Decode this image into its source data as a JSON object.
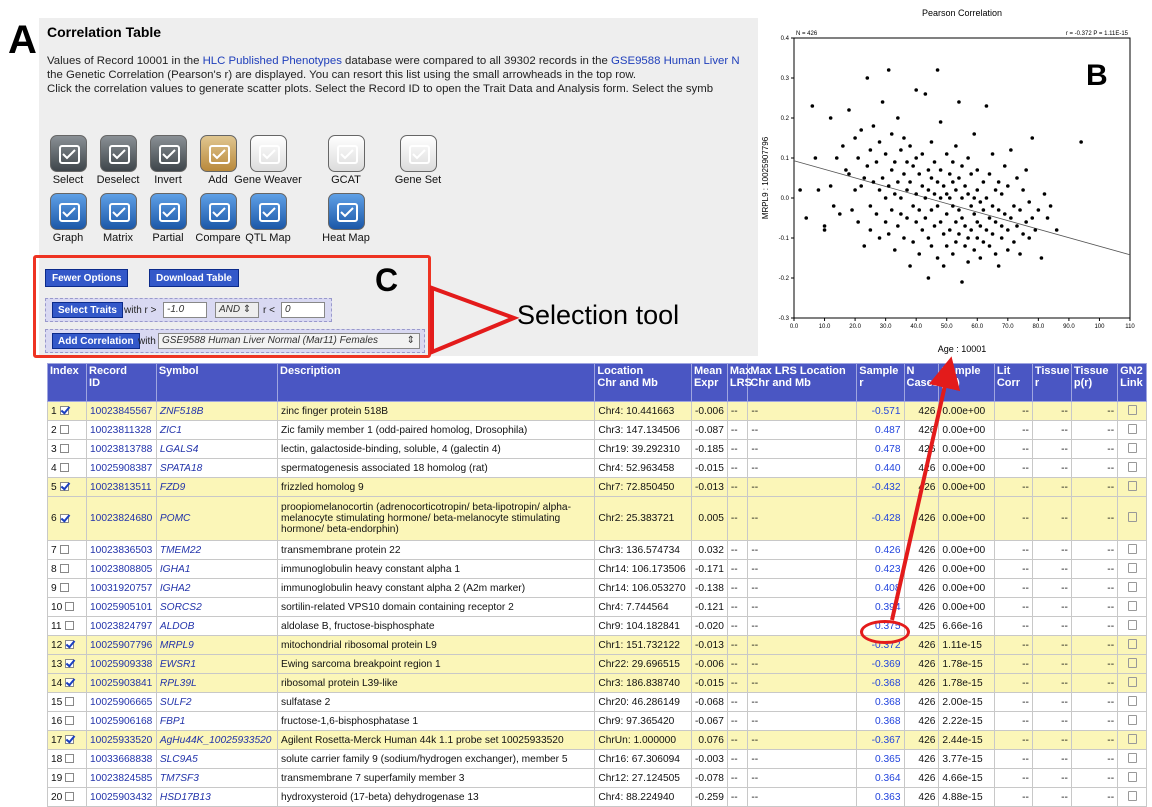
{
  "panel_labels": {
    "a": "A",
    "b": "B",
    "c": "C"
  },
  "header": {
    "title": "Correlation Table",
    "line1_pre": "Values of Record 10001 in the ",
    "line1_db1": "HLC Published Phenotypes",
    "line1_mid": " database were compared to all 39302 records in the ",
    "line1_db2": "GSE9588 Human Liver N",
    "line2": "the Genetic Correlation (Pearson's r) are displayed. You can resort this list using the small arrowheads in the top row.",
    "line3": "Click the correlation values to generate scatter plots. Select the Record ID to open the Trait Data and Analysis form. Select the symb"
  },
  "tools_row1": [
    "Select",
    "Deselect",
    "Invert",
    "Add",
    "Gene Weaver",
    "GCAT",
    "Gene Set"
  ],
  "tools_row2": [
    "Graph",
    "Matrix",
    "Partial",
    "Compare",
    "QTL Map",
    "Heat Map"
  ],
  "options": {
    "fewer_options": "Fewer Options",
    "download_table": "Download Table",
    "select_traits": "Select Traits",
    "with_r_gt": "with r >",
    "r_min": "-1.0",
    "logic": "AND",
    "r_lt": "r <",
    "r_max": "0",
    "add_correlation": "Add Correlation",
    "with": "with",
    "dataset": "GSE9588 Human Liver Normal (Mar11) Females"
  },
  "annotation": {
    "selection_tool": "Selection tool"
  },
  "colors": {
    "header_blue": "#4a56c3",
    "selected_row": "#fbf6b8",
    "red": "#e31b1b",
    "button_blue": "#3358c9"
  },
  "chart_data": {
    "type": "scatter",
    "title": "Pearson Correlation",
    "xlabel": "Age : 10001",
    "ylabel": "MRPL9 : 10025907796",
    "n_label": "N = 426",
    "stat_label": "r = -0.372 P = 1.11E-15",
    "xlim": [
      0,
      110
    ],
    "ylim": [
      -0.3,
      0.4
    ],
    "xticks": [
      "0.0",
      "10.0",
      "20.0",
      "30.0",
      "40.0",
      "50.0",
      "60.0",
      "70.0",
      "80.0",
      "90.0",
      "100",
      "110"
    ],
    "yticks": [
      "-0.3",
      "-0.2",
      "-0.1",
      "0.0",
      "0.1",
      "0.2",
      "0.3",
      "0.4"
    ],
    "regression": {
      "x": [
        0,
        110
      ],
      "y": [
        0.093,
        -0.142
      ]
    },
    "points": [
      [
        2,
        0.02
      ],
      [
        4,
        -0.05
      ],
      [
        6,
        0.23
      ],
      [
        7,
        0.1
      ],
      [
        8,
        0.02
      ],
      [
        10,
        -0.08
      ],
      [
        10,
        -0.07
      ],
      [
        12,
        0.2
      ],
      [
        12,
        0.03
      ],
      [
        13,
        -0.02
      ],
      [
        14,
        0.1
      ],
      [
        15,
        -0.04
      ],
      [
        16,
        0.13
      ],
      [
        17,
        0.07
      ],
      [
        18,
        0.22
      ],
      [
        18,
        0.06
      ],
      [
        19,
        -0.03
      ],
      [
        20,
        0.15
      ],
      [
        20,
        0.02
      ],
      [
        21,
        0.1
      ],
      [
        21,
        -0.06
      ],
      [
        22,
        0.03
      ],
      [
        22,
        0.17
      ],
      [
        23,
        -0.12
      ],
      [
        23,
        0.05
      ],
      [
        24,
        0.3
      ],
      [
        24,
        0.08
      ],
      [
        25,
        0.12
      ],
      [
        25,
        -0.02
      ],
      [
        25,
        -0.08
      ],
      [
        26,
        0.04
      ],
      [
        26,
        0.18
      ],
      [
        27,
        -0.04
      ],
      [
        27,
        0.09
      ],
      [
        28,
        0.02
      ],
      [
        28,
        -0.1
      ],
      [
        28,
        0.14
      ],
      [
        29,
        0.24
      ],
      [
        29,
        0.05
      ],
      [
        30,
        -0.06
      ],
      [
        30,
        0.11
      ],
      [
        30,
        0.0
      ],
      [
        31,
        0.32
      ],
      [
        31,
        0.03
      ],
      [
        31,
        -0.09
      ],
      [
        32,
        0.07
      ],
      [
        32,
        -0.03
      ],
      [
        32,
        0.16
      ],
      [
        33,
        -0.13
      ],
      [
        33,
        0.01
      ],
      [
        33,
        0.09
      ],
      [
        34,
        0.04
      ],
      [
        34,
        -0.07
      ],
      [
        34,
        0.2
      ],
      [
        35,
        0.0
      ],
      [
        35,
        0.12
      ],
      [
        35,
        -0.04
      ],
      [
        36,
        0.06
      ],
      [
        36,
        -0.1
      ],
      [
        36,
        0.15
      ],
      [
        37,
        0.02
      ],
      [
        37,
        -0.05
      ],
      [
        37,
        0.09
      ],
      [
        38,
        -0.17
      ],
      [
        38,
        0.04
      ],
      [
        38,
        0.13
      ],
      [
        39,
        -0.02
      ],
      [
        39,
        0.08
      ],
      [
        39,
        -0.11
      ],
      [
        40,
        0.01
      ],
      [
        40,
        0.27
      ],
      [
        40,
        -0.06
      ],
      [
        40,
        0.1
      ],
      [
        41,
        -0.03
      ],
      [
        41,
        0.06
      ],
      [
        41,
        -0.14
      ],
      [
        42,
        0.03
      ],
      [
        42,
        -0.08
      ],
      [
        42,
        0.11
      ],
      [
        43,
        0.26
      ],
      [
        43,
        0.0
      ],
      [
        43,
        -0.05
      ],
      [
        44,
        0.07
      ],
      [
        44,
        -0.1
      ],
      [
        44,
        0.02
      ],
      [
        44,
        -0.2
      ],
      [
        45,
        0.05
      ],
      [
        45,
        -0.03
      ],
      [
        45,
        0.14
      ],
      [
        45,
        -0.12
      ],
      [
        46,
        0.01
      ],
      [
        46,
        -0.07
      ],
      [
        46,
        0.09
      ],
      [
        47,
        0.32
      ],
      [
        47,
        -0.02
      ],
      [
        47,
        0.04
      ],
      [
        47,
        -0.15
      ],
      [
        48,
        0.19
      ],
      [
        48,
        -0.06
      ],
      [
        48,
        0.0
      ],
      [
        48,
        0.07
      ],
      [
        49,
        -0.09
      ],
      [
        49,
        0.03
      ],
      [
        49,
        -0.17
      ],
      [
        50,
        0.11
      ],
      [
        50,
        -0.04
      ],
      [
        50,
        0.01
      ],
      [
        50,
        -0.12
      ],
      [
        51,
        0.06
      ],
      [
        51,
        -0.08
      ],
      [
        51,
        0.0
      ],
      [
        52,
        -0.02
      ],
      [
        52,
        0.09
      ],
      [
        52,
        -0.14
      ],
      [
        52,
        0.04
      ],
      [
        53,
        -0.06
      ],
      [
        53,
        0.02
      ],
      [
        53,
        -0.11
      ],
      [
        53,
        0.13
      ],
      [
        54,
        0.24
      ],
      [
        54,
        -0.03
      ],
      [
        54,
        0.05
      ],
      [
        54,
        -0.09
      ],
      [
        55,
        -0.21
      ],
      [
        55,
        0.0
      ],
      [
        55,
        -0.05
      ],
      [
        55,
        0.08
      ],
      [
        56,
        -0.12
      ],
      [
        56,
        0.03
      ],
      [
        56,
        -0.07
      ],
      [
        57,
        0.01
      ],
      [
        57,
        -0.1
      ],
      [
        57,
        0.1
      ],
      [
        57,
        -0.16
      ],
      [
        58,
        -0.02
      ],
      [
        58,
        0.06
      ],
      [
        58,
        -0.08
      ],
      [
        59,
        0.16
      ],
      [
        59,
        -0.04
      ],
      [
        59,
        0.0
      ],
      [
        59,
        -0.13
      ],
      [
        60,
        -0.06
      ],
      [
        60,
        0.02
      ],
      [
        60,
        -0.1
      ],
      [
        60,
        0.07
      ],
      [
        61,
        -0.15
      ],
      [
        61,
        -0.01
      ],
      [
        61,
        -0.07
      ],
      [
        62,
        0.04
      ],
      [
        62,
        -0.11
      ],
      [
        62,
        -0.03
      ],
      [
        63,
        0.23
      ],
      [
        63,
        -0.08
      ],
      [
        63,
        0.0
      ],
      [
        64,
        -0.05
      ],
      [
        64,
        -0.12
      ],
      [
        64,
        0.06
      ],
      [
        65,
        -0.02
      ],
      [
        65,
        -0.09
      ],
      [
        65,
        0.11
      ],
      [
        66,
        -0.14
      ],
      [
        66,
        0.02
      ],
      [
        66,
        -0.06
      ],
      [
        67,
        -0.17
      ],
      [
        67,
        -0.03
      ],
      [
        67,
        0.04
      ],
      [
        68,
        -0.1
      ],
      [
        68,
        0.01
      ],
      [
        68,
        -0.07
      ],
      [
        69,
        0.08
      ],
      [
        69,
        -0.04
      ],
      [
        70,
        -0.13
      ],
      [
        70,
        0.03
      ],
      [
        70,
        -0.08
      ],
      [
        71,
        0.12
      ],
      [
        71,
        -0.05
      ],
      [
        72,
        -0.02
      ],
      [
        72,
        -0.11
      ],
      [
        73,
        0.05
      ],
      [
        73,
        -0.07
      ],
      [
        74,
        -0.03
      ],
      [
        74,
        -0.14
      ],
      [
        75,
        0.02
      ],
      [
        75,
        -0.09
      ],
      [
        76,
        -0.06
      ],
      [
        76,
        0.07
      ],
      [
        77,
        -0.1
      ],
      [
        77,
        -0.01
      ],
      [
        78,
        0.15
      ],
      [
        78,
        -0.05
      ],
      [
        79,
        -0.08
      ],
      [
        80,
        -0.03
      ],
      [
        81,
        -0.15
      ],
      [
        82,
        0.01
      ],
      [
        83,
        -0.05
      ],
      [
        84,
        -0.02
      ],
      [
        86,
        -0.08
      ],
      [
        94,
        0.14
      ]
    ]
  },
  "table": {
    "columns": [
      {
        "l1": "Index",
        "l2": ""
      },
      {
        "l1": "Record",
        "l2": "ID"
      },
      {
        "l1": "Symbol",
        "l2": ""
      },
      {
        "l1": "Description",
        "l2": ""
      },
      {
        "l1": "Location",
        "l2": "Chr and Mb"
      },
      {
        "l1": "Mean",
        "l2": "Expr"
      },
      {
        "l1": "Max",
        "l2": "LRS"
      },
      {
        "l1": "Max LRS Location",
        "l2": "Chr and Mb"
      },
      {
        "l1": "Sample",
        "l2": "r"
      },
      {
        "l1": "N",
        "l2": "Cases"
      },
      {
        "l1": "Sample",
        "l2": "p(r)"
      },
      {
        "l1": "Lit",
        "l2": "Corr"
      },
      {
        "l1": "Tissue",
        "l2": "r"
      },
      {
        "l1": "Tissue",
        "l2": "p(r)"
      },
      {
        "l1": "GN2",
        "l2": "Link"
      }
    ],
    "rows": [
      {
        "i": "1",
        "c": true,
        "id": "10023845567",
        "sym": "ZNF518B",
        "desc": "zinc finger protein 518B",
        "loc": "Chr4: 10.441663",
        "mean": "-0.006",
        "lrs": "--",
        "lrsloc": "--",
        "r": "-0.571",
        "n": "426",
        "p": "0.00e+00",
        "lit": "--",
        "tr": "--",
        "tp": "--"
      },
      {
        "i": "2",
        "c": false,
        "id": "10023811328",
        "sym": "ZIC1",
        "desc": "Zic family member 1 (odd-paired homolog, Drosophila)",
        "loc": "Chr3: 147.134506",
        "mean": "-0.087",
        "lrs": "--",
        "lrsloc": "--",
        "r": "0.487",
        "n": "426",
        "p": "0.00e+00",
        "lit": "--",
        "tr": "--",
        "tp": "--"
      },
      {
        "i": "3",
        "c": false,
        "id": "10023813788",
        "sym": "LGALS4",
        "desc": "lectin, galactoside-binding, soluble, 4 (galectin 4)",
        "loc": "Chr19: 39.292310",
        "mean": "-0.185",
        "lrs": "--",
        "lrsloc": "--",
        "r": "0.478",
        "n": "426",
        "p": "0.00e+00",
        "lit": "--",
        "tr": "--",
        "tp": "--"
      },
      {
        "i": "4",
        "c": false,
        "id": "10025908387",
        "sym": "SPATA18",
        "desc": "spermatogenesis associated 18 homolog (rat)",
        "loc": "Chr4: 52.963458",
        "mean": "-0.015",
        "lrs": "--",
        "lrsloc": "--",
        "r": "0.440",
        "n": "426",
        "p": "0.00e+00",
        "lit": "--",
        "tr": "--",
        "tp": "--"
      },
      {
        "i": "5",
        "c": true,
        "id": "10023813511",
        "sym": "FZD9",
        "desc": "frizzled homolog 9",
        "loc": "Chr7: 72.850450",
        "mean": "-0.013",
        "lrs": "--",
        "lrsloc": "--",
        "r": "-0.432",
        "n": "426",
        "p": "0.00e+00",
        "lit": "--",
        "tr": "--",
        "tp": "--"
      },
      {
        "i": "6",
        "c": true,
        "id": "10023824680",
        "sym": "POMC",
        "desc": "proopiomelanocortin (adrenocorticotropin/ beta-lipotropin/ alpha-melanocyte stimulating hormone/ beta-melanocyte stimulating hormone/ beta-endorphin)",
        "loc": "Chr2: 25.383721",
        "mean": "0.005",
        "lrs": "--",
        "lrsloc": "--",
        "r": "-0.428",
        "n": "426",
        "p": "0.00e+00",
        "lit": "--",
        "tr": "--",
        "tp": "--",
        "tall": true
      },
      {
        "i": "7",
        "c": false,
        "id": "10023836503",
        "sym": "TMEM22",
        "desc": "transmembrane protein 22",
        "loc": "Chr3: 136.574734",
        "mean": "0.032",
        "lrs": "--",
        "lrsloc": "--",
        "r": "0.426",
        "n": "426",
        "p": "0.00e+00",
        "lit": "--",
        "tr": "--",
        "tp": "--"
      },
      {
        "i": "8",
        "c": false,
        "id": "10023808805",
        "sym": "IGHA1",
        "desc": "immunoglobulin heavy constant alpha 1",
        "loc": "Chr14: 106.173506",
        "mean": "-0.171",
        "lrs": "--",
        "lrsloc": "--",
        "r": "0.423",
        "n": "426",
        "p": "0.00e+00",
        "lit": "--",
        "tr": "--",
        "tp": "--"
      },
      {
        "i": "9",
        "c": false,
        "id": "10031920757",
        "sym": "IGHA2",
        "desc": "immunoglobulin heavy constant alpha 2 (A2m marker)",
        "loc": "Chr14: 106.053270",
        "mean": "-0.138",
        "lrs": "--",
        "lrsloc": "--",
        "r": "0.408",
        "n": "426",
        "p": "0.00e+00",
        "lit": "--",
        "tr": "--",
        "tp": "--"
      },
      {
        "i": "10",
        "c": false,
        "id": "10025905101",
        "sym": "SORCS2",
        "desc": "sortilin-related VPS10 domain containing receptor 2",
        "loc": "Chr4: 7.744564",
        "mean": "-0.121",
        "lrs": "--",
        "lrsloc": "--",
        "r": "0.394",
        "n": "426",
        "p": "0.00e+00",
        "lit": "--",
        "tr": "--",
        "tp": "--"
      },
      {
        "i": "11",
        "c": false,
        "id": "10023824797",
        "sym": "ALDOB",
        "desc": "aldolase B, fructose-bisphosphate",
        "loc": "Chr9: 104.182841",
        "mean": "-0.020",
        "lrs": "--",
        "lrsloc": "--",
        "r": "0.375",
        "n": "425",
        "p": "6.66e-16",
        "lit": "--",
        "tr": "--",
        "tp": "--"
      },
      {
        "i": "12",
        "c": true,
        "id": "10025907796",
        "sym": "MRPL9",
        "desc": "mitochondrial ribosomal protein L9",
        "loc": "Chr1: 151.732122",
        "mean": "-0.013",
        "lrs": "--",
        "lrsloc": "--",
        "r": "-0.372",
        "n": "426",
        "p": "1.11e-15",
        "lit": "--",
        "tr": "--",
        "tp": "--"
      },
      {
        "i": "13",
        "c": true,
        "id": "10025909338",
        "sym": "EWSR1",
        "desc": "Ewing sarcoma breakpoint region 1",
        "loc": "Chr22: 29.696515",
        "mean": "-0.006",
        "lrs": "--",
        "lrsloc": "--",
        "r": "-0.369",
        "n": "426",
        "p": "1.78e-15",
        "lit": "--",
        "tr": "--",
        "tp": "--"
      },
      {
        "i": "14",
        "c": true,
        "id": "10025903841",
        "sym": "RPL39L",
        "desc": "ribosomal protein L39-like",
        "loc": "Chr3: 186.838740",
        "mean": "-0.015",
        "lrs": "--",
        "lrsloc": "--",
        "r": "-0.368",
        "n": "426",
        "p": "1.78e-15",
        "lit": "--",
        "tr": "--",
        "tp": "--"
      },
      {
        "i": "15",
        "c": false,
        "id": "10025906665",
        "sym": "SULF2",
        "desc": "sulfatase 2",
        "loc": "Chr20: 46.286149",
        "mean": "-0.068",
        "lrs": "--",
        "lrsloc": "--",
        "r": "0.368",
        "n": "426",
        "p": "2.00e-15",
        "lit": "--",
        "tr": "--",
        "tp": "--"
      },
      {
        "i": "16",
        "c": false,
        "id": "10025906168",
        "sym": "FBP1",
        "desc": "fructose-1,6-bisphosphatase 1",
        "loc": "Chr9: 97.365420",
        "mean": "-0.067",
        "lrs": "--",
        "lrsloc": "--",
        "r": "0.368",
        "n": "426",
        "p": "2.22e-15",
        "lit": "--",
        "tr": "--",
        "tp": "--"
      },
      {
        "i": "17",
        "c": true,
        "id": "10025933520",
        "sym": "AgHu44K_10025933520",
        "desc": "Agilent Rosetta-Merck Human 44k 1.1 probe set 10025933520",
        "loc": "ChrUn: 1.000000",
        "mean": "0.076",
        "lrs": "--",
        "lrsloc": "--",
        "r": "-0.367",
        "n": "426",
        "p": "2.44e-15",
        "lit": "--",
        "tr": "--",
        "tp": "--"
      },
      {
        "i": "18",
        "c": false,
        "id": "10033668838",
        "sym": "SLC9A5",
        "desc": "solute carrier family 9 (sodium/hydrogen exchanger), member 5",
        "loc": "Chr16: 67.306094",
        "mean": "-0.003",
        "lrs": "--",
        "lrsloc": "--",
        "r": "0.365",
        "n": "426",
        "p": "3.77e-15",
        "lit": "--",
        "tr": "--",
        "tp": "--"
      },
      {
        "i": "19",
        "c": false,
        "id": "10023824585",
        "sym": "TM7SF3",
        "desc": "transmembrane 7 superfamily member 3",
        "loc": "Chr12: 27.124505",
        "mean": "-0.078",
        "lrs": "--",
        "lrsloc": "--",
        "r": "0.364",
        "n": "426",
        "p": "4.66e-15",
        "lit": "--",
        "tr": "--",
        "tp": "--"
      },
      {
        "i": "20",
        "c": false,
        "id": "10025903432",
        "sym": "HSD17B13",
        "desc": "hydroxysteroid (17-beta) dehydrogenase 13",
        "loc": "Chr4: 88.224940",
        "mean": "-0.259",
        "lrs": "--",
        "lrsloc": "--",
        "r": "0.363",
        "n": "426",
        "p": "4.88e-15",
        "lit": "--",
        "tr": "--",
        "tp": "--"
      }
    ]
  }
}
